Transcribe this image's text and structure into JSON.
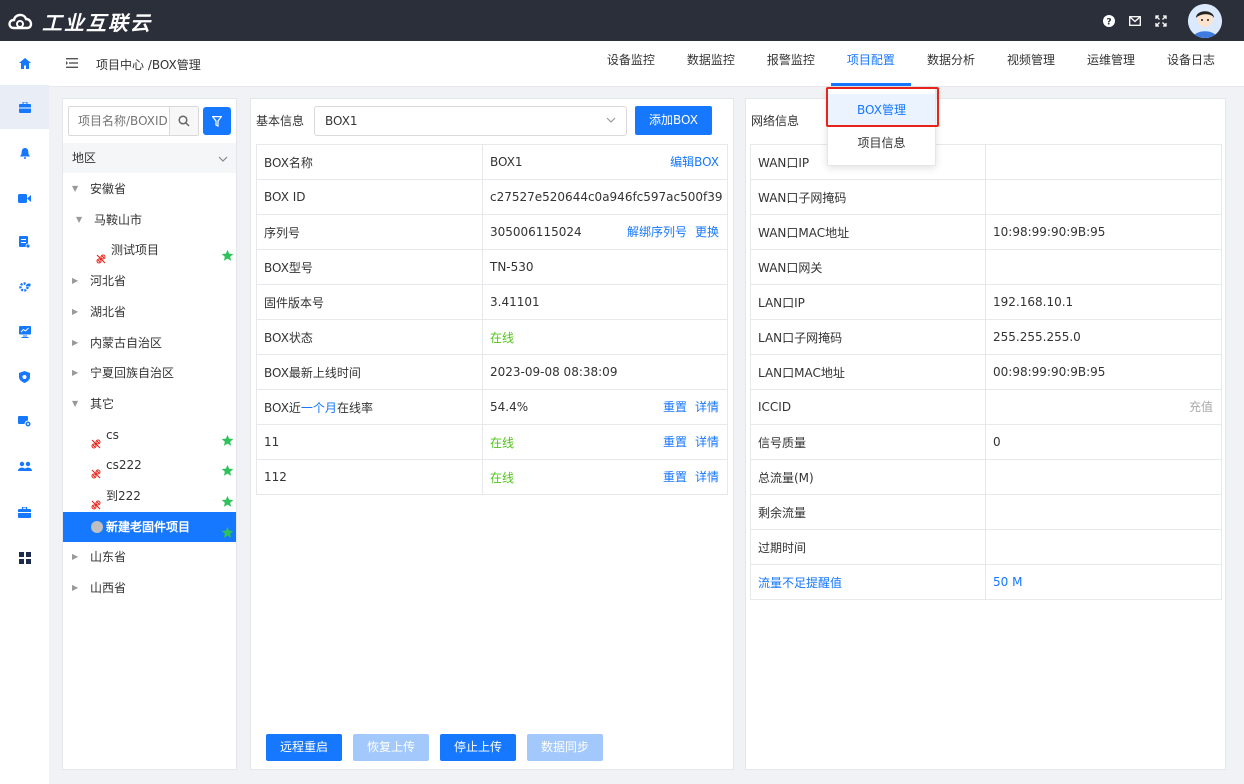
{
  "app": {
    "title": "工业互联云"
  },
  "topbar": {
    "icons": [
      "help-icon",
      "mail-icon",
      "fullscreen-icon",
      "avatar"
    ]
  },
  "leftnav": {
    "items": [
      "home-icon",
      "project-icon",
      "alarm-icon",
      "video-icon",
      "report-icon",
      "settings-icon",
      "monitor-icon",
      "shield-icon",
      "device-config-icon",
      "users-icon",
      "briefcase-icon",
      "grid-icon"
    ]
  },
  "breadcrumb": "项目中心 /BOX管理",
  "tabs": [
    {
      "label": "设备监控"
    },
    {
      "label": "数据监控"
    },
    {
      "label": "报警监控"
    },
    {
      "label": "项目配置",
      "active": true
    },
    {
      "label": "数据分析"
    },
    {
      "label": "视频管理"
    },
    {
      "label": "运维管理"
    },
    {
      "label": "设备日志"
    }
  ],
  "dropdown": {
    "items": [
      "BOX管理",
      "项目信息"
    ],
    "active_index": 0
  },
  "tree": {
    "search_placeholder": "项目名称/BOXID",
    "region_label": "地区",
    "nodes": [
      {
        "label": "安徽省",
        "expanded": true
      },
      {
        "label": "马鞍山市",
        "expanded": true
      },
      {
        "label": "测试项目",
        "starred": true
      },
      {
        "label": "河北省"
      },
      {
        "label": "湖北省"
      },
      {
        "label": "内蒙古自治区"
      },
      {
        "label": "宁夏回族自治区"
      },
      {
        "label": "其它",
        "expanded": true
      },
      {
        "label": "cs",
        "starred": true
      },
      {
        "label": "cs222",
        "starred": true
      },
      {
        "label": "到222",
        "starred": true
      },
      {
        "label": "新建老固件项目",
        "starred": true,
        "selected": true
      },
      {
        "label": "山东省"
      },
      {
        "label": "山西省"
      }
    ]
  },
  "basic": {
    "section_label": "基本信息",
    "selected_box": "BOX1",
    "add_button": "添加BOX",
    "rows": [
      {
        "label": "BOX名称",
        "value": "BOX1",
        "actions": [
          "编辑BOX"
        ]
      },
      {
        "label": "BOX ID",
        "value": "c27527e520644c0a946fc597ac500f39",
        "actions": []
      },
      {
        "label": "序列号",
        "value": "305006115024",
        "actions": [
          "解绑序列号",
          "更换"
        ]
      },
      {
        "label": "BOX型号",
        "value": "TN-530",
        "actions": []
      },
      {
        "label": "固件版本号",
        "value": "3.41101",
        "actions": []
      },
      {
        "label": "BOX状态",
        "value": "在线",
        "actions": [],
        "status": true
      },
      {
        "label": "BOX最新上线时间",
        "value": "2023-09-08 08:38:09",
        "actions": []
      },
      {
        "label_prefix": "BOX近",
        "label_link": "一个月",
        "label_suffix": "在线率",
        "value": "54.4%",
        "actions": [
          "重置",
          "详情"
        ]
      },
      {
        "label": "11",
        "value": "在线",
        "actions": [
          "重置",
          "详情"
        ],
        "status": true
      },
      {
        "label": "112",
        "value": "在线",
        "actions": [
          "重置",
          "详情"
        ],
        "status": true
      }
    ],
    "buttons": [
      {
        "label": "远程重启",
        "enabled": true
      },
      {
        "label": "恢复上传",
        "enabled": false
      },
      {
        "label": "停止上传",
        "enabled": true
      },
      {
        "label": "数据同步",
        "enabled": false
      }
    ]
  },
  "network": {
    "section_label": "网络信息",
    "rows": [
      {
        "label": "WAN口IP",
        "value": ""
      },
      {
        "label": "WAN口子网掩码",
        "value": ""
      },
      {
        "label": "WAN口MAC地址",
        "value": "10:98:99:90:9B:95"
      },
      {
        "label": "WAN口网关",
        "value": ""
      },
      {
        "label": "LAN口IP",
        "value": "192.168.10.1"
      },
      {
        "label": "LAN口子网掩码",
        "value": "255.255.255.0"
      },
      {
        "label": "LAN口MAC地址",
        "value": "00:98:99:90:9B:95"
      },
      {
        "label": "ICCID",
        "value": "",
        "action": "充值"
      },
      {
        "label": "信号质量",
        "value": "0"
      },
      {
        "label": "总流量(M)",
        "value": ""
      },
      {
        "label": "剩余流量",
        "value": ""
      },
      {
        "label": "过期时间",
        "value": ""
      },
      {
        "label": "流量不足提醒值",
        "value": "50  M",
        "link": true
      }
    ]
  },
  "colors": {
    "primary": "#1677ff",
    "online": "#52c41a",
    "topbar": "#2b2f3a",
    "highlight": "#e8231a",
    "star": "#2fc25b"
  }
}
